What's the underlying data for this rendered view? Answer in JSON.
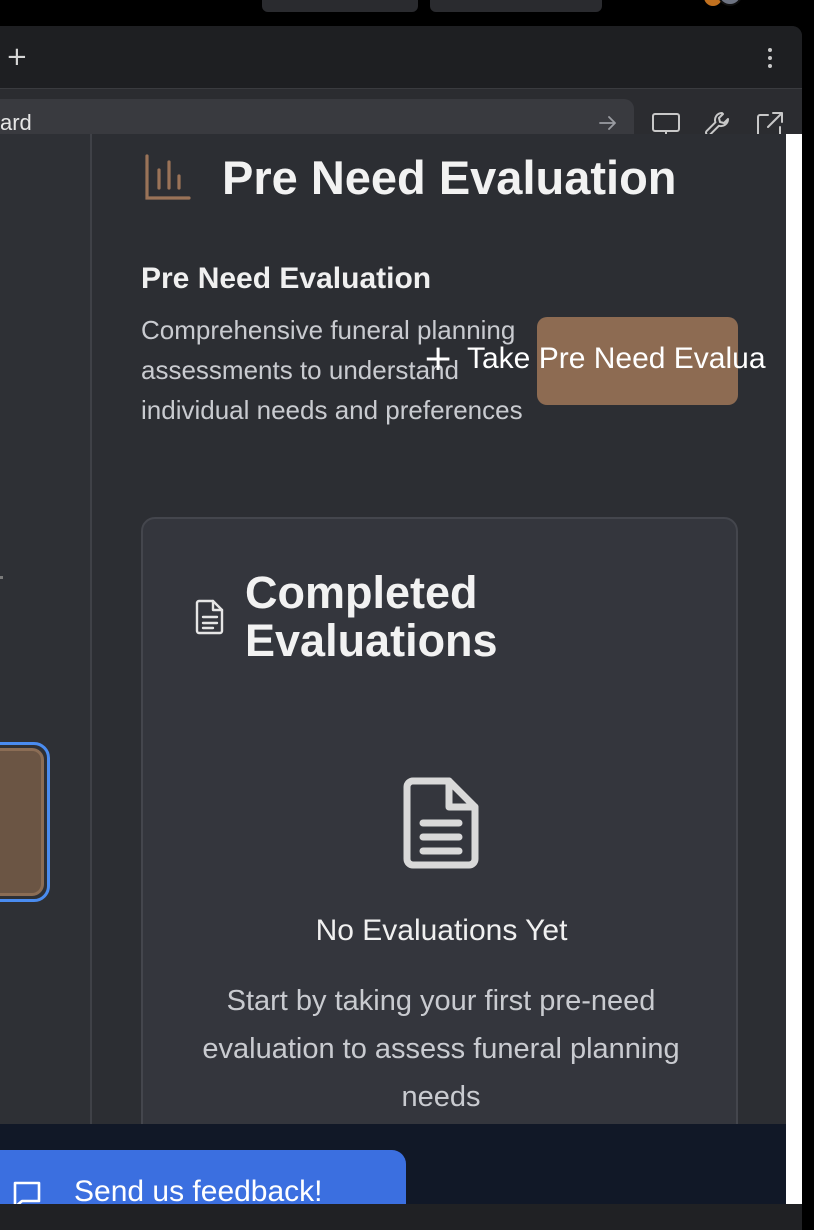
{
  "browser": {
    "url_text": "ard",
    "new_tab_symbol": "+"
  },
  "page": {
    "title": "Pre Need Evaluation"
  },
  "section": {
    "title": "Pre Need Evaluation",
    "description": "Comprehensive funeral planning assessments to understand individual needs and preferences",
    "button_plus": "+",
    "button_label": "Take Pre Need Evalua"
  },
  "card": {
    "title": "Completed Evaluations",
    "empty_title": "No Evaluations Yet",
    "empty_description": "Start by taking your first pre-need evaluation to assess funeral planning needs"
  },
  "feedback": {
    "label": "Send us feedback!"
  },
  "colors": {
    "accent": "#8d6b52",
    "feedback": "#3b6fe0",
    "focus_ring": "#4a8cf0"
  }
}
